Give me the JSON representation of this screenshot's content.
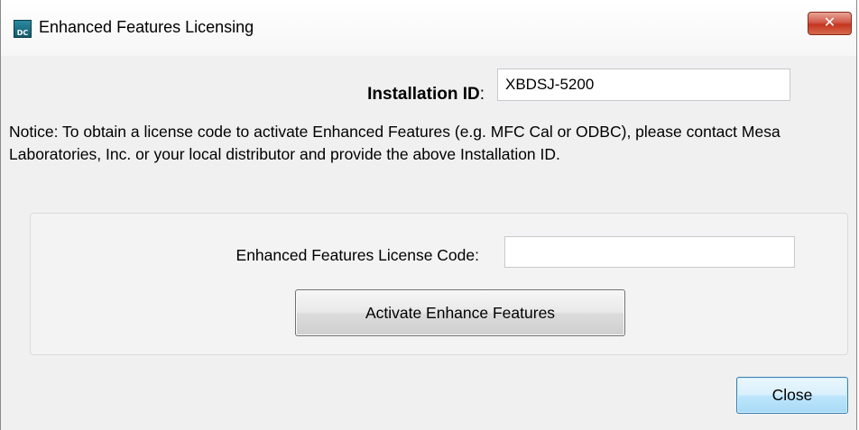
{
  "window": {
    "title": "Enhanced Features Licensing",
    "icon_text": "DC",
    "close_glyph": "✕"
  },
  "installation": {
    "label": "Installation ID",
    "colon": ":",
    "value": "XBDSJ-5200"
  },
  "notice": {
    "text": "Notice:  To obtain a license code to activate Enhanced Features (e.g. MFC Cal or ODBC), please contact Mesa Laboratories, Inc. or your local distributor and provide the above Installation ID."
  },
  "license": {
    "label": "Enhanced Features License Code:",
    "value": "",
    "activate_label": "Activate Enhance Features"
  },
  "footer": {
    "close_label": "Close"
  },
  "colors": {
    "window_bg": "#f0f0f0",
    "close_x_red": "#c6341f",
    "focus_button_blue": "#3c7fb1"
  }
}
